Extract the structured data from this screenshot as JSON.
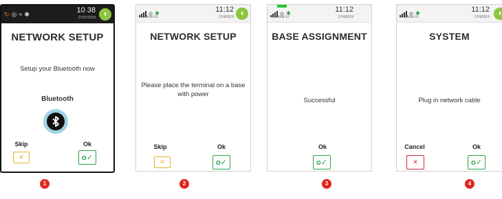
{
  "colors": {
    "skip": "#e8b22a",
    "ok": "#27a547",
    "cancel": "#d4263a",
    "step_badge": "#e0261b",
    "battery": "#8cc63f"
  },
  "screens": [
    {
      "status": {
        "time": "10 38",
        "date": "27/07/2018"
      },
      "title": "NETWORK SETUP",
      "subtitle": "Setup your Bluetooth now",
      "bluetooth_label": "Bluetooth",
      "icon": "bluetooth-icon",
      "skip_label": "Skip",
      "ok_label": "Ok",
      "step": "1"
    },
    {
      "status": {
        "time": "11:12",
        "date": "17/4/2019",
        "carrier": "vodafone UI"
      },
      "title": "NETWORK SETUP",
      "message": "Please place the terminal on a base with power",
      "skip_label": "Skip",
      "ok_label": "Ok",
      "step": "2"
    },
    {
      "status": {
        "time": "11:12",
        "date": "17/4/2019",
        "carrier": "vodafone UI"
      },
      "title": "BASE ASSIGNMENT",
      "message": "Successful",
      "ok_label": "Ok",
      "step": "3"
    },
    {
      "status": {
        "time": "11:12",
        "date": "17/4/2019",
        "carrier": "vodafone UI"
      },
      "title": "SYSTEM",
      "message": "Plug in network cable",
      "cancel_label": "Cancel",
      "ok_label": "Ok",
      "step": "4"
    }
  ]
}
